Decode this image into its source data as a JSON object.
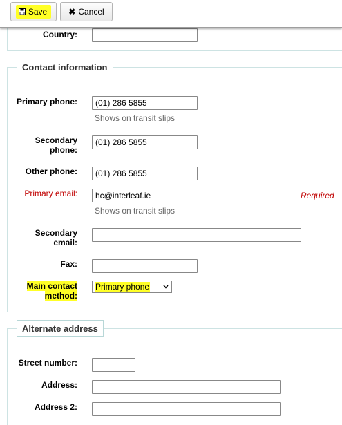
{
  "toolbar": {
    "save_label": "Save",
    "save_icon": "floppy-disk-icon",
    "cancel_label": "Cancel",
    "cancel_icon": "x-icon",
    "highlight_color": "#ffff26"
  },
  "address_section": {
    "country_label": "Country:",
    "country_value": ""
  },
  "contact": {
    "legend": "Contact information",
    "primary_phone_label": "Primary phone:",
    "primary_phone_value": "(01) 286 5855",
    "primary_phone_hint": "Shows on transit slips",
    "secondary_phone_label_1": "Secondary",
    "secondary_phone_label_2": "phone:",
    "secondary_phone_value": "(01) 286 5855",
    "other_phone_label": "Other phone:",
    "other_phone_value": "(01) 286 5855",
    "primary_email_label": "Primary email:",
    "primary_email_value": "hc@interleaf.ie",
    "primary_email_required": "Required",
    "primary_email_hint": "Shows on transit slips",
    "secondary_email_label_1": "Secondary",
    "secondary_email_label_2": "email:",
    "secondary_email_value": "",
    "fax_label": "Fax:",
    "fax_value": "",
    "main_contact_label_1": "Main contact",
    "main_contact_label_2": "method:",
    "main_contact_value": "Primary phone",
    "required_color": "#c00000"
  },
  "alternate": {
    "legend": "Alternate address",
    "street_number_label": "Street number:",
    "street_number_value": "",
    "address_label": "Address:",
    "address_value": "",
    "address2_label": "Address 2:",
    "address2_value": ""
  }
}
